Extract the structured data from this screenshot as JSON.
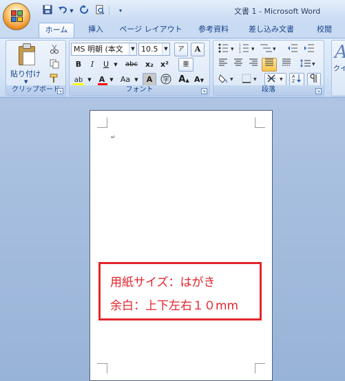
{
  "window": {
    "title": "文書 1 - Microsoft Word"
  },
  "quick_access": {
    "save_icon": "save-icon",
    "undo_icon": "undo-icon",
    "redo_icon": "redo-icon",
    "print_preview_icon": "print-preview-icon",
    "customize_icon": "customize-icon"
  },
  "tabs": [
    {
      "label": "ホーム",
      "active": true
    },
    {
      "label": "挿入",
      "active": false
    },
    {
      "label": "ページ レイアウト",
      "active": false
    },
    {
      "label": "参考資料",
      "active": false
    },
    {
      "label": "差し込み文書",
      "active": false
    },
    {
      "label": "校閲",
      "active": false
    }
  ],
  "ribbon": {
    "clipboard": {
      "label": "クリップボード",
      "paste_label": "貼り付け"
    },
    "font": {
      "label": "フォント",
      "font_name": "MS 明朝 (本文",
      "font_size": "10.5",
      "bold": "B",
      "italic": "I",
      "underline": "U",
      "strikethrough": "abc",
      "subscript": "x₂",
      "superscript": "x²",
      "change_case": "Aa",
      "grow_font": "A",
      "shrink_font": "A"
    },
    "paragraph": {
      "label": "段落"
    },
    "styles": {
      "label": "クイック スタイル"
    }
  },
  "annotation": {
    "line1": "用紙サイズ：はがき",
    "line2": "余白：上下左右１０mm"
  },
  "colors": {
    "annotation_red": "#e3242b",
    "ribbon_blue": "#15428b",
    "highlight_yellow": "#ffff00",
    "font_color_red": "#ff0000",
    "active_button_orange": "#f8c34a"
  }
}
